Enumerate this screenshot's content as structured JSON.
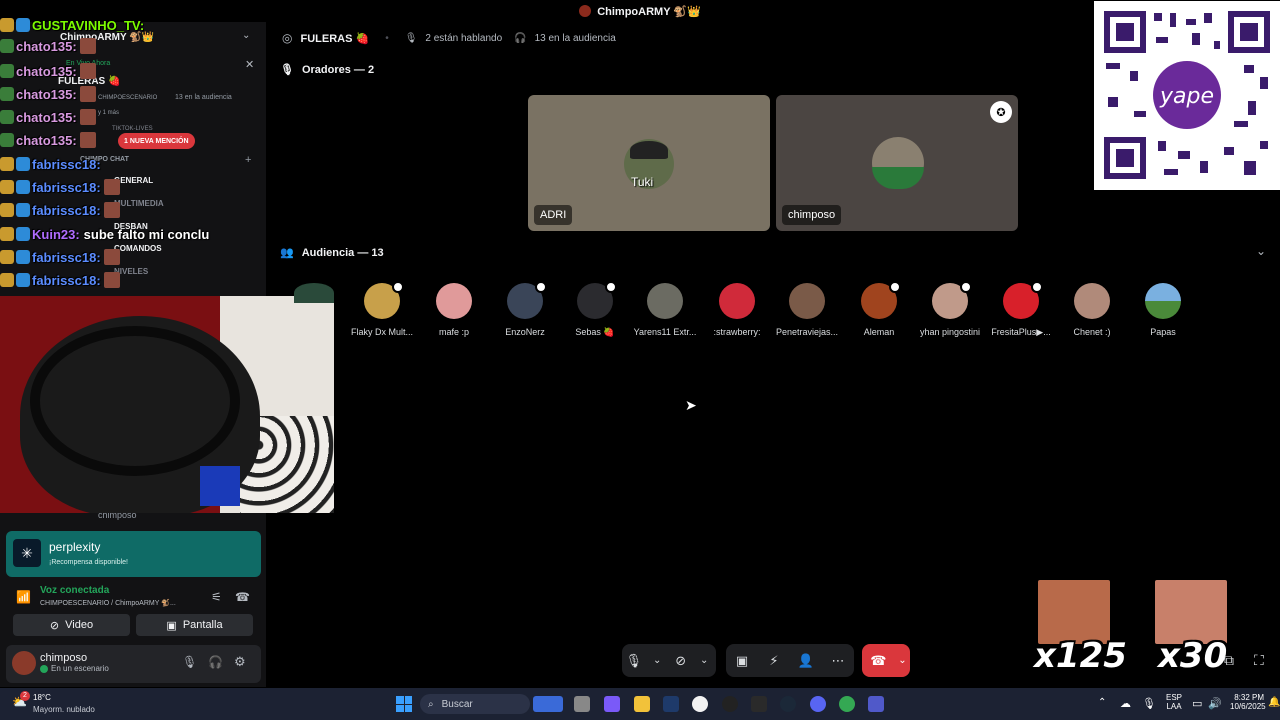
{
  "title_bar": {
    "server_name": "ChimpoARMY 🐒👑"
  },
  "stage": {
    "channel_name": "FULERAS 🍓",
    "speaking_count": "2 están hablando",
    "audience_count": "13 en la audiencia",
    "speakers_label": "Oradores — 2",
    "audience_label": "Audiencia — 13",
    "speakers": [
      {
        "name": "ADRI",
        "overlay_text": "Tuki"
      },
      {
        "name": "chimposo"
      }
    ],
    "audience": [
      {
        "name": "Flaky Dx Mult..."
      },
      {
        "name": "mafe :p"
      },
      {
        "name": "EnzoNerz"
      },
      {
        "name": "Sebas 🍓"
      },
      {
        "name": "Yarens11 Extr..."
      },
      {
        "name": ":strawberry:"
      },
      {
        "name": "Penetraviejas..."
      },
      {
        "name": "Aleman"
      },
      {
        "name": "yhan pingostini"
      },
      {
        "name": "FresitaPlus▶..."
      },
      {
        "name": "Chenet :)"
      },
      {
        "name": "Papas"
      }
    ]
  },
  "sidebar": {
    "server_name": "ChimpoARMY 🐒👑",
    "live_label": "En Vivo Ahora",
    "live_channel": "FULERAS 🍓",
    "live_sub": "CHIMPOESCENARIO",
    "live_audience": "13 en la audiencia",
    "live_more": "y 1 más",
    "mention_badge": "1 NUEVA MENCIÓN",
    "category": "CHIMPO CHAT",
    "channels": [
      "TIKTOK-LIVES",
      "GENERAL",
      "MULTIMEDIA",
      "DESBAN",
      "COMANDOS",
      "NIVELES"
    ]
  },
  "chat": [
    {
      "user": "GUSTAVINHO_TV:",
      "text": "",
      "color": "#7CFC00"
    },
    {
      "user": "chato135:",
      "text": "",
      "color": "#d89ae0"
    },
    {
      "user": "chato135:",
      "text": "",
      "color": "#d89ae0"
    },
    {
      "user": "chato135:",
      "text": "",
      "color": "#d89ae0"
    },
    {
      "user": "chato135:",
      "text": "",
      "color": "#d89ae0"
    },
    {
      "user": "chato135:",
      "text": "",
      "color": "#d89ae0"
    },
    {
      "user": "fabrissc18:",
      "text": "",
      "color": "#5b8cff"
    },
    {
      "user": "fabrissc18:",
      "text": "",
      "color": "#5b8cff"
    },
    {
      "user": "fabrissc18:",
      "text": "",
      "color": "#5b8cff"
    },
    {
      "user": "Kuin23:",
      "text": "sube falto mi conclu",
      "color": "#b06cff"
    },
    {
      "user": "fabrissc18:",
      "text": "",
      "color": "#5b8cff"
    },
    {
      "user": "fabrissc18:",
      "text": "",
      "color": "#5b8cff"
    }
  ],
  "voice": {
    "webcam_user": "chimposo",
    "promo_title": "perplexity",
    "promo_sub": "¡Recompensa disponible!",
    "status": "Voz conectada",
    "path": "CHIMPOESCENARIO / ChimpoARMY 🐒...",
    "video_label": "Video",
    "screen_label": "Pantalla",
    "username": "chimposo",
    "user_status": "En un escenario"
  },
  "emote_counters": [
    "x125",
    "x30"
  ],
  "taskbar": {
    "temperature": "18°C",
    "weather": "Mayorm. nublado",
    "weather_badge": "2",
    "search_placeholder": "Buscar",
    "lang": "ESP",
    "lang_sub": "LAA",
    "time": "8:32 PM",
    "date": "10/6/2025"
  },
  "colors": {
    "accent": "#5865f2",
    "danger": "#da373c",
    "green": "#23a55a",
    "promo": "#0f6b66"
  }
}
